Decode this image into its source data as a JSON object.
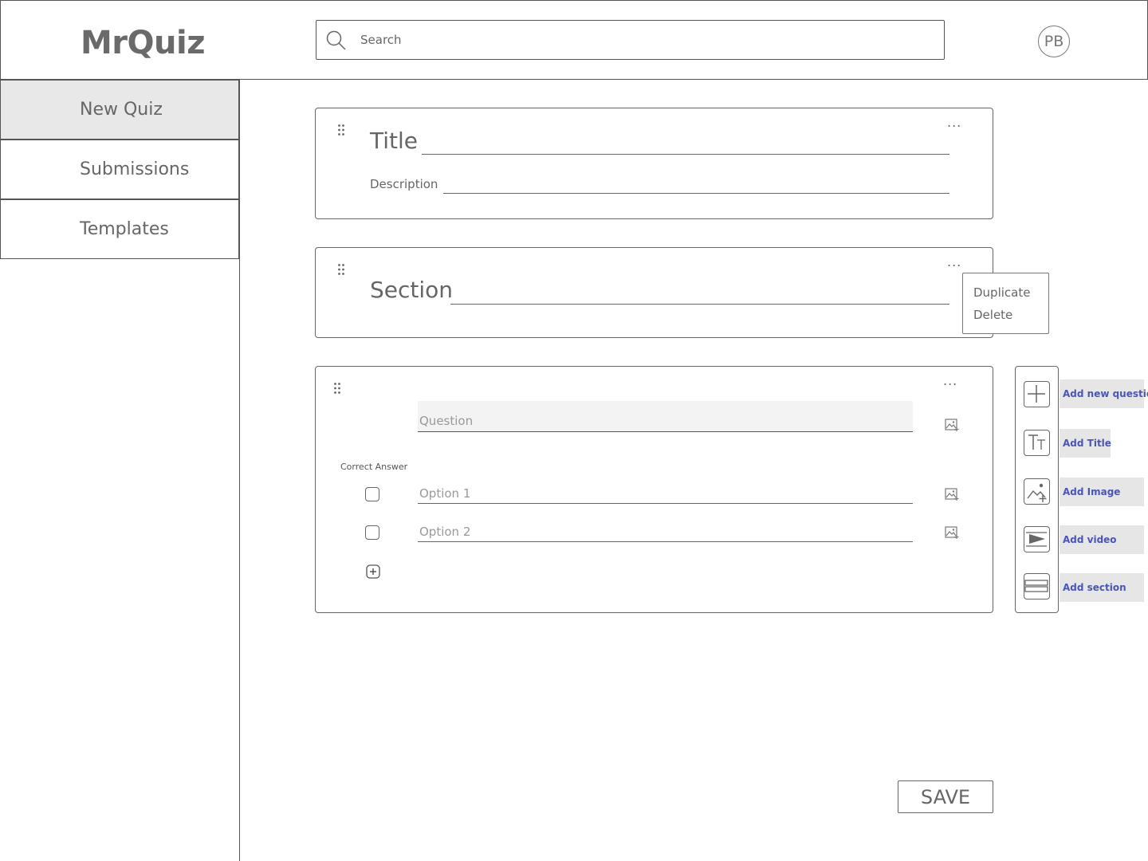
{
  "header": {
    "logo": "MrQuiz",
    "search": {
      "placeholder": "Search",
      "value": ""
    },
    "avatar_initials": "PB"
  },
  "sidebar": {
    "items": [
      {
        "label": "New Quiz",
        "active": true
      },
      {
        "label": "Submissions",
        "active": false
      },
      {
        "label": "Templates",
        "active": false
      }
    ]
  },
  "title_card": {
    "title_label": "Title",
    "description_label": "Description",
    "menu": "..."
  },
  "section_card": {
    "section_label": "Section",
    "menu": "...",
    "context_menu": [
      "Duplicate",
      "Delete"
    ]
  },
  "question_card": {
    "menu": "...",
    "question_placeholder": "Question",
    "correct_answer_label": "Correct Answer",
    "options": [
      {
        "placeholder": "Option 1",
        "checked": false
      },
      {
        "placeholder": "Option 2",
        "checked": false
      }
    ]
  },
  "toolbar": {
    "items": [
      {
        "icon": "plus-icon",
        "label": "Add new question"
      },
      {
        "icon": "text-size-icon",
        "label": "Add Title"
      },
      {
        "icon": "add-image-icon",
        "label": "Add Image"
      },
      {
        "icon": "video-icon",
        "label": "Add video"
      },
      {
        "icon": "section-icon",
        "label": "Add section"
      }
    ]
  },
  "save_label": "SAVE",
  "colors": {
    "accent": "#4a55b8",
    "border": "#555555",
    "active_nav": "#e8e8e8",
    "label_bg": "#e6e6e6"
  }
}
